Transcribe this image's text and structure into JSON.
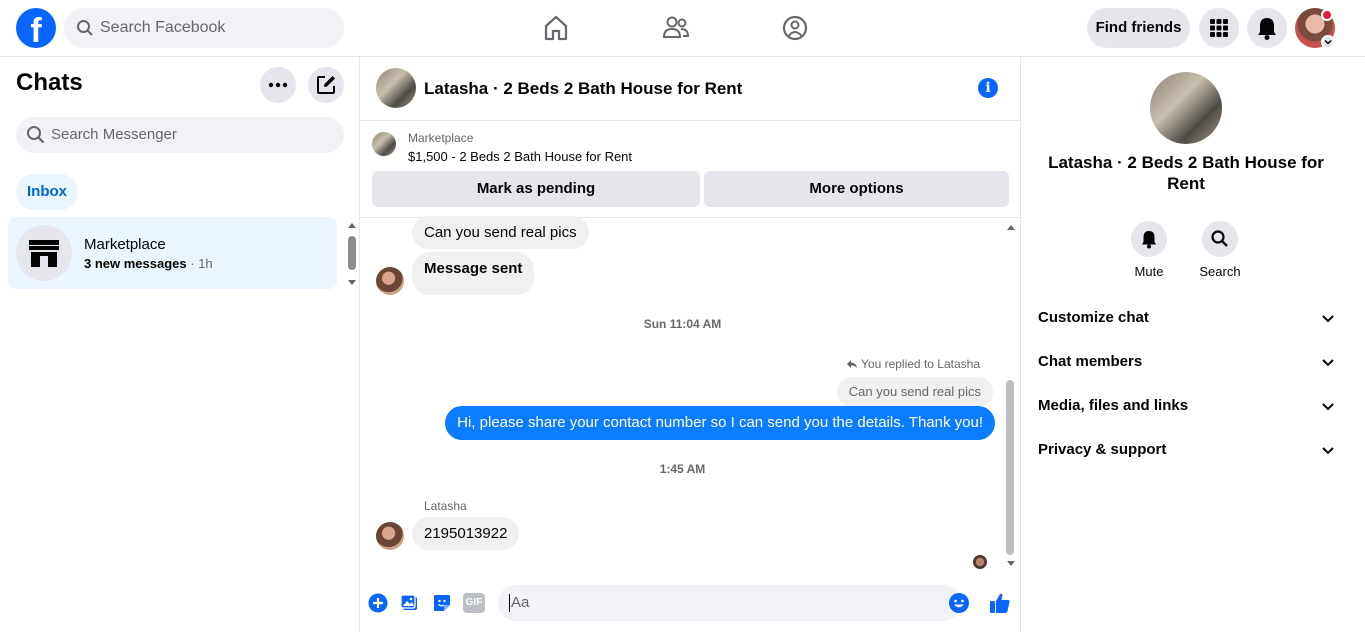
{
  "topbar": {
    "logo": "f",
    "search_placeholder": "Search Facebook",
    "find_friends": "Find friends",
    "icons": [
      "home-icon",
      "friends-icon",
      "groups-icon",
      "menu-grid-icon",
      "bell-icon"
    ]
  },
  "left": {
    "title": "Chats",
    "search_placeholder": "Search Messenger",
    "filter": "Inbox",
    "conversations": [
      {
        "name": "Marketplace",
        "preview": "3 new messages",
        "time": "· 1h"
      }
    ]
  },
  "thread": {
    "title": "Latasha · 2 Beds 2 Bath House for Rent",
    "listing": {
      "label": "Marketplace",
      "price_title": "$1,500 - 2 Beds 2 Bath House for Rent",
      "mark_pending": "Mark as pending",
      "more_options": "More options"
    },
    "messages": {
      "in1": "Can you send real pics",
      "in2": "Message sent",
      "ts1": "Sun 11:04 AM",
      "replied_to": "You replied to Latasha",
      "quoted": "Can you send real pics",
      "out1": "Hi, please share your contact number so I can send you the details. Thank you!",
      "ts2": "1:45 AM",
      "sender": "Latasha",
      "in3": "2195013922"
    },
    "composer_placeholder": "Aa",
    "gif_label": "GIF"
  },
  "details": {
    "name": "Latasha · 2 Beds 2 Bath House for Rent",
    "actions": [
      {
        "label": "Mute"
      },
      {
        "label": "Search"
      }
    ],
    "sections": [
      "Customize chat",
      "Chat members",
      "Media, files and links",
      "Privacy & support"
    ]
  },
  "colors": {
    "brand": "#0866ff",
    "outgoing_bubble": "#0a7cff",
    "selected": "#ebf5ff"
  }
}
